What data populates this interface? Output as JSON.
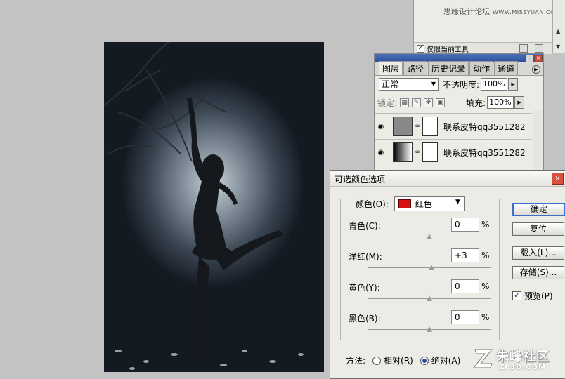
{
  "top_panel": {
    "site_cn": "思缘设计论坛",
    "site_en": "WWW.MISSYUAN.COM",
    "checkbox_label": "仅限当前工具"
  },
  "layers_panel": {
    "tabs": [
      "图层",
      "路径",
      "历史记录",
      "动作",
      "通道"
    ],
    "blend_mode": "正常",
    "opacity_label": "不透明度:",
    "opacity_value": "100%",
    "lock_label": "锁定:",
    "fill_label": "填充:",
    "fill_value": "100%",
    "layers": [
      {
        "name": "联系皮特qq3551282"
      },
      {
        "name": "联系皮特qq3551282"
      }
    ]
  },
  "dialog": {
    "title": "可选颜色选项",
    "colors_label": "颜色(O):",
    "colors_value": "红色",
    "sliders": [
      {
        "label": "青色(C):",
        "value": "0",
        "fraction": 0.5
      },
      {
        "label": "洋红(M):",
        "value": "+3",
        "fraction": 0.515
      },
      {
        "label": "黄色(Y):",
        "value": "0",
        "fraction": 0.5
      },
      {
        "label": "黑色(B):",
        "value": "0",
        "fraction": 0.5
      }
    ],
    "percent": "%",
    "buttons": {
      "ok": "确定",
      "reset": "复位",
      "load": "载入(L)...",
      "save": "存储(S)..."
    },
    "preview_label": "预览(P)",
    "method_label": "方法:",
    "method_relative": "相对(R)",
    "method_absolute": "绝对(A)",
    "swatch_color": "#d41212"
  },
  "watermark": {
    "cn": "朱峰社区",
    "en": "ZF3D.COM"
  }
}
